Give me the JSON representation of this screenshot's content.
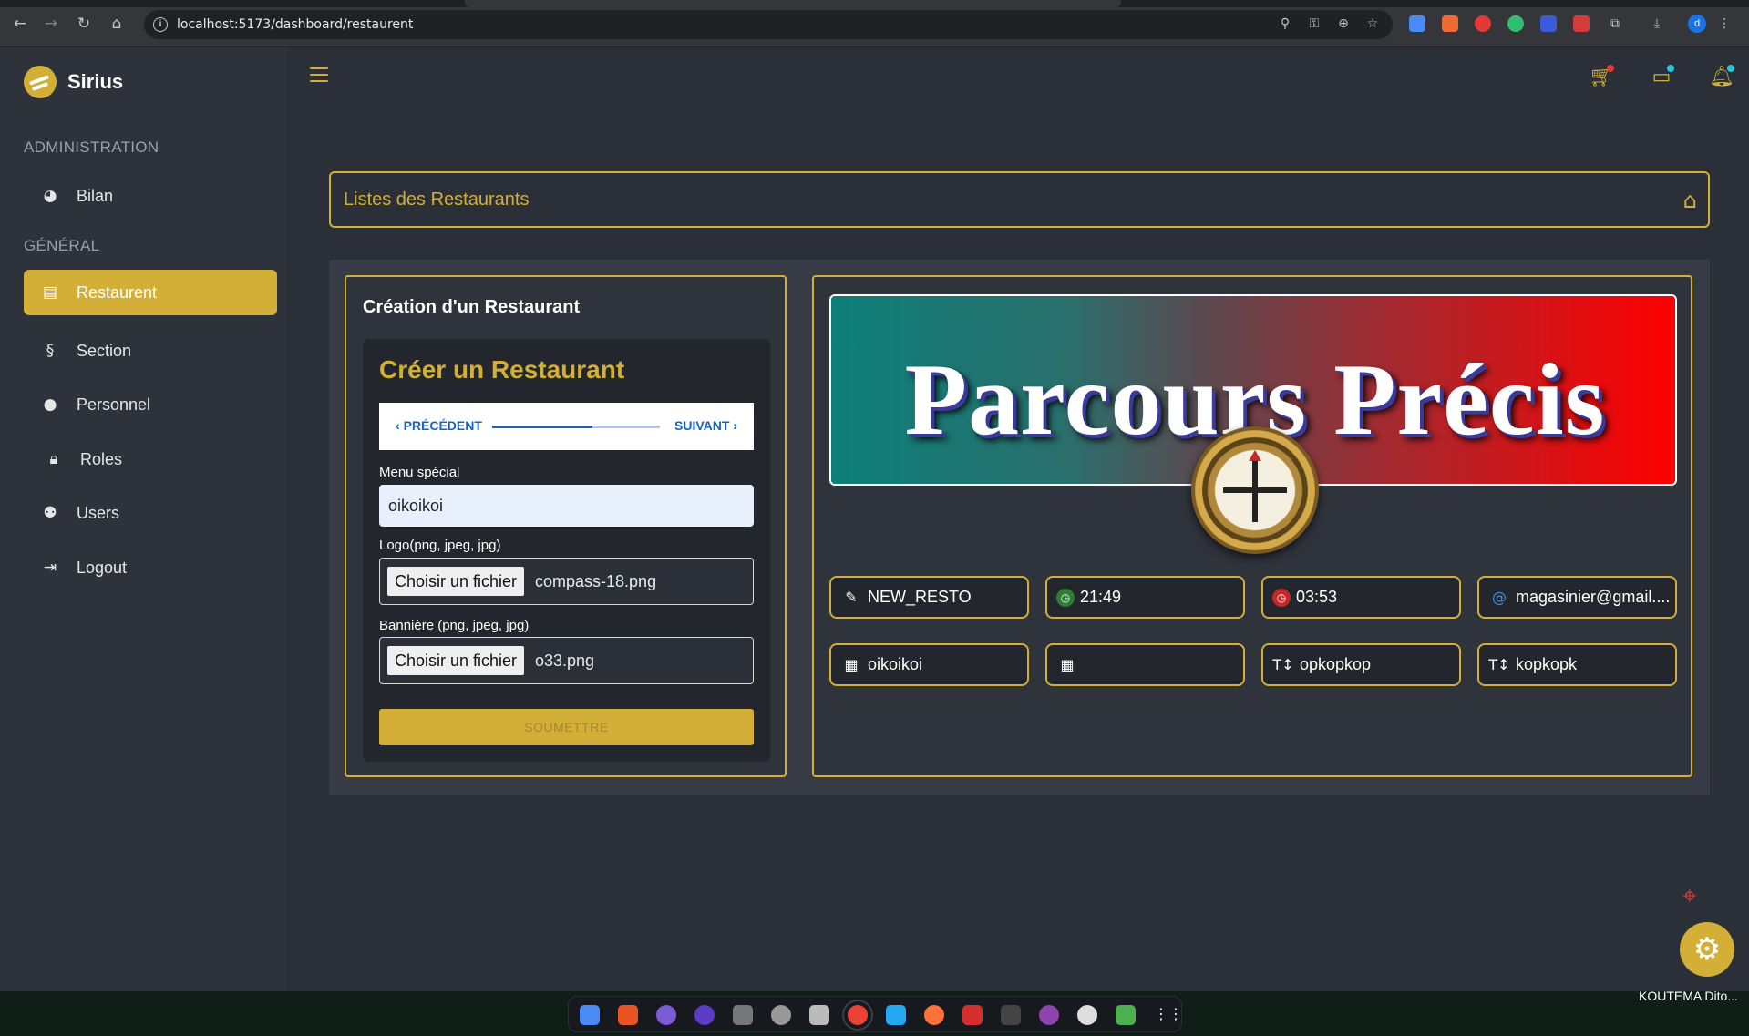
{
  "browser": {
    "url": "localhost:5173/dashboard/restaurent",
    "profile_initial": "d"
  },
  "sidebar": {
    "brand": "Sirius",
    "sections": [
      {
        "title": "ADMINISTRATION"
      },
      {
        "title": "GÉNÉRAL"
      }
    ],
    "items": [
      {
        "label": "Bilan",
        "icon": "dashboard-icon"
      },
      {
        "label": "Restaurent",
        "icon": "store-icon",
        "active": true
      },
      {
        "label": "Section",
        "icon": "section-icon"
      },
      {
        "label": "Personnel",
        "icon": "user-icon"
      },
      {
        "label": "Roles",
        "icon": "lock-icon"
      },
      {
        "label": "Users",
        "icon": "users-icon"
      },
      {
        "label": "Logout",
        "icon": "logout-icon"
      }
    ]
  },
  "header": {
    "title": "Listes des Restaurants"
  },
  "form": {
    "card_title": "Création d'un Restaurant",
    "heading": "Créer un Restaurant",
    "stepper": {
      "prev": "PRÉCÉDENT",
      "next": "SUIVANT",
      "progress": 0.6
    },
    "menu_label": "Menu spécial",
    "menu_value": "oikoikoi",
    "logo_label": "Logo(png, jpeg, jpg)",
    "logo_button": "Choisir un fichier",
    "logo_file": "compass-18.png",
    "banner_label": "Bannière (png, jpeg, jpg)",
    "banner_button": "Choisir un fichier",
    "banner_file": "o33.png",
    "submit": "SOUMETTRE"
  },
  "preview": {
    "banner_text": "Parcours Précis",
    "chips": [
      {
        "icon": "edit-icon",
        "text": "NEW_RESTO"
      },
      {
        "icon": "clock-open-icon",
        "text": "21:49"
      },
      {
        "icon": "clock-close-icon",
        "text": "03:53"
      },
      {
        "icon": "at-icon",
        "text": "magasinier@gmail...."
      },
      {
        "icon": "calendar-icon",
        "text": "oikoikoi"
      },
      {
        "icon": "calendar-icon",
        "text": ""
      },
      {
        "icon": "sort-icon",
        "text": "opkopkop"
      },
      {
        "icon": "sort-icon",
        "text": "kopkopk"
      }
    ]
  },
  "taskbar": {
    "tray_text": "KOUTEMA Dito..."
  },
  "colors": {
    "accent": "#d4af37",
    "background": "#2b2f38",
    "sidebar": "#2e323b"
  }
}
